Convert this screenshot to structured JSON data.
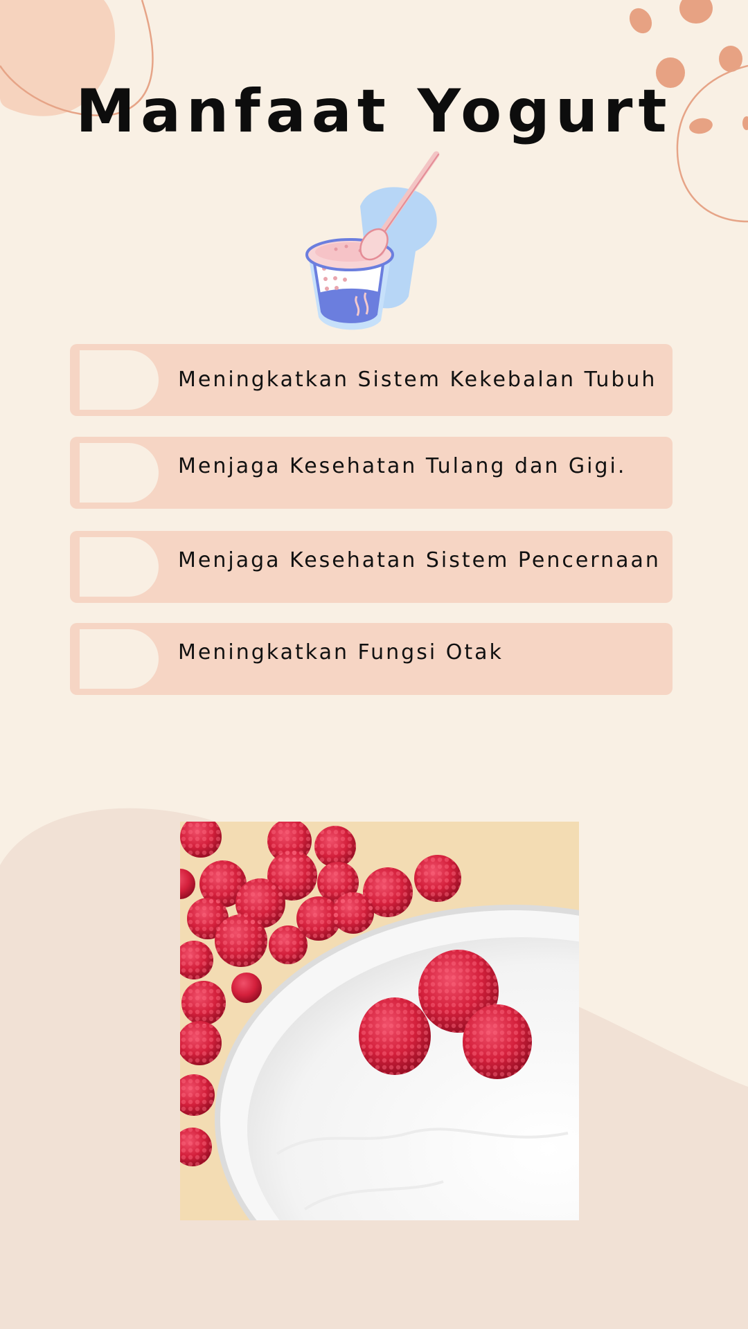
{
  "title": "Manfaat Yogurt",
  "colors": {
    "background": "#f9f0e4",
    "accent_peach": "#f6d5c4",
    "accent_terracotta": "#e7a283",
    "lower_background": "#f1e1d5"
  },
  "illustration": {
    "name": "yogurt-cup-with-spoon"
  },
  "benefits": [
    {
      "label": "Meningkatkan Sistem Kekebalan Tubuh"
    },
    {
      "label": "Menjaga Kesehatan Tulang dan Gigi."
    },
    {
      "label": "Menjaga Kesehatan Sistem Pencernaan"
    },
    {
      "label": "Meningkatkan Fungsi Otak"
    }
  ],
  "photo": {
    "name": "yogurt-bowl-with-raspberries"
  }
}
